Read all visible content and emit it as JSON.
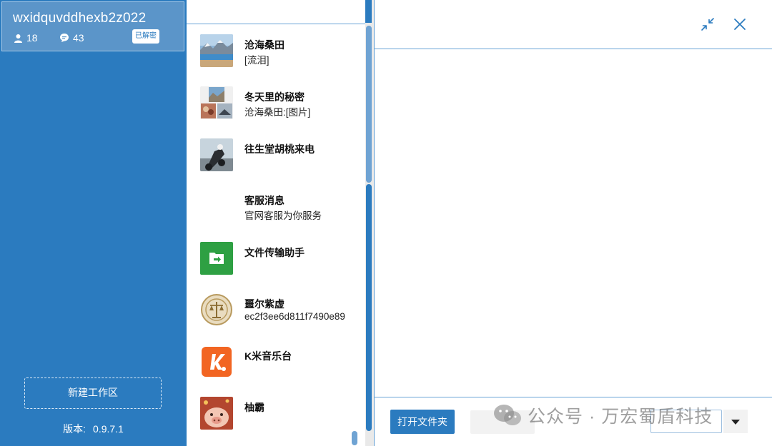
{
  "account": {
    "id": "wxidquvddhexb2z022",
    "contacts_count": "18",
    "chats_count": "43",
    "decrypt_status": "已解密"
  },
  "sidebar": {
    "new_workspace_label": "新建工作区",
    "version_label": "版本:",
    "version_value": "0.9.7.1"
  },
  "chats": [
    {
      "name": "沧海桑田",
      "preview": "[流泪]",
      "avatar": "landscape-photo"
    },
    {
      "name": "冬天里的秘密",
      "preview": "沧海桑田:[图片]",
      "avatar": "group-collage"
    },
    {
      "name": "往生堂胡桃来电",
      "preview": "",
      "avatar": "motorbike-photo"
    },
    {
      "name": "客服消息",
      "preview": "官网客服为你服务",
      "avatar": "none"
    },
    {
      "name": "文件传输助手",
      "preview": "",
      "avatar": "file-transfer-icon"
    },
    {
      "name": "噩尔紫虚",
      "preview": "ec2f3ee6d811f7490e89",
      "avatar": "emblem"
    },
    {
      "name": "K米音乐台",
      "preview": "",
      "avatar": "k-music-logo"
    },
    {
      "name": "柚霸",
      "preview": "",
      "avatar": "pig-photo"
    }
  ],
  "footer": {
    "open_folder_label": "打开文件夹"
  },
  "watermark": {
    "text": "公众号 · 万宏蜀盾科技"
  },
  "colors": {
    "primary": "#2b7bbf",
    "card": "#5b95c9",
    "divider": "#6aa3d6",
    "file_transfer_green": "#2ea043",
    "k_music_orange": "#f26522"
  }
}
